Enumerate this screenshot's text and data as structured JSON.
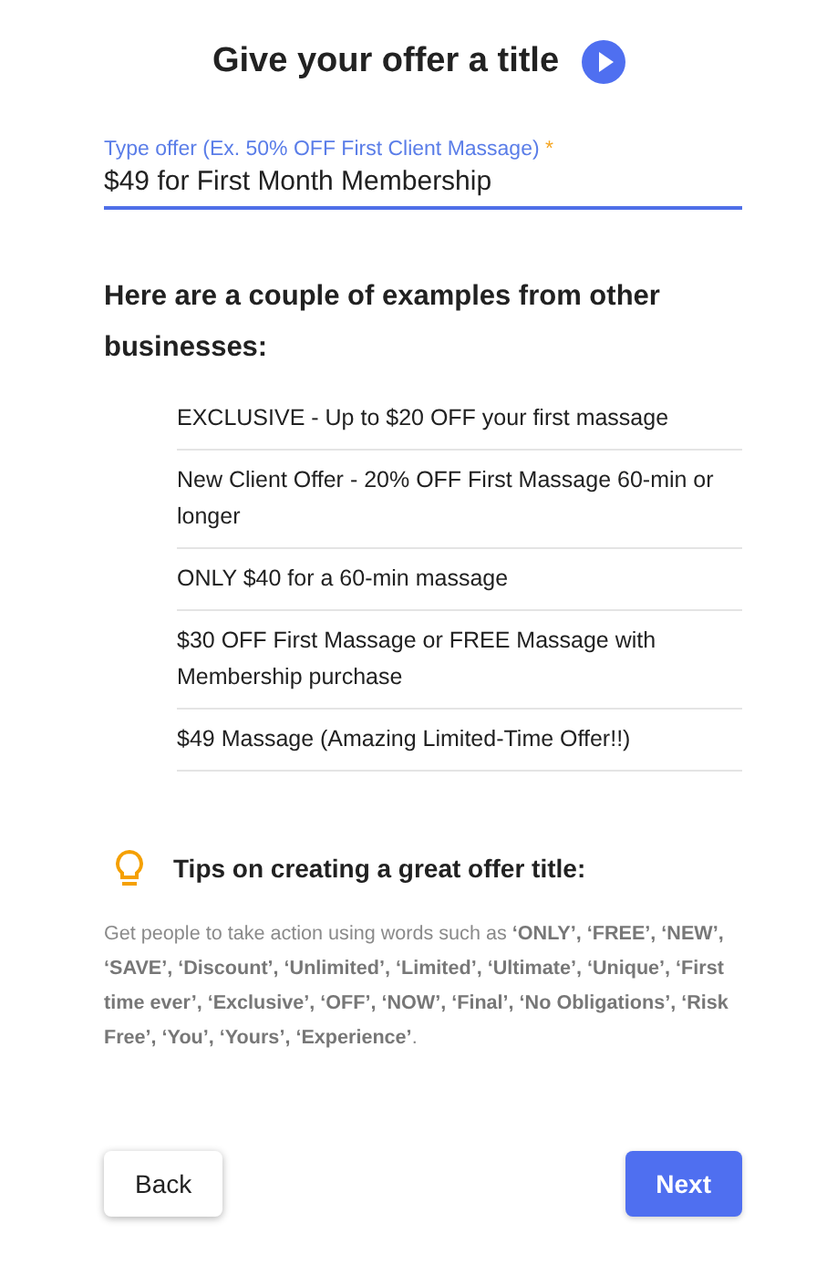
{
  "title": "Give your offer a title",
  "field": {
    "label": "Type offer (Ex. 50% OFF First Client Massage)",
    "required_mark": "*",
    "value": "$49 for First Month Membership",
    "focused": true
  },
  "examples": {
    "heading": "Here are a couple of examples from other businesses:",
    "items": [
      "EXCLUSIVE - Up to $20 OFF your first massage",
      "New Client Offer - 20% OFF First Massage 60-min or longer",
      "ONLY $40 for a 60-min massage",
      "$30 OFF First Massage or FREE Massage with Membership purchase",
      "$49 Massage (Amazing Limited-Time Offer!!)"
    ]
  },
  "tips": {
    "heading": "Tips on creating a great offer title:",
    "text": "Get people to take action using words such as **‘ONLY’, ‘FREE’, ‘NEW’, ‘SAVE’, ‘Discount’, ‘Unlimited’, ‘Limited’, ‘Ultimate’, ‘Unique’, ‘First time ever’, ‘Exclusive’, ‘OFF’, ‘NOW’, ‘Final’, ‘No Obligations’, ‘Risk Free’, ‘You’, ‘Yours’, ‘Experience’**."
  },
  "buttons": [
    {
      "label": "Back",
      "kind": "secondary"
    },
    {
      "label": "Next",
      "kind": "primary"
    }
  ]
}
